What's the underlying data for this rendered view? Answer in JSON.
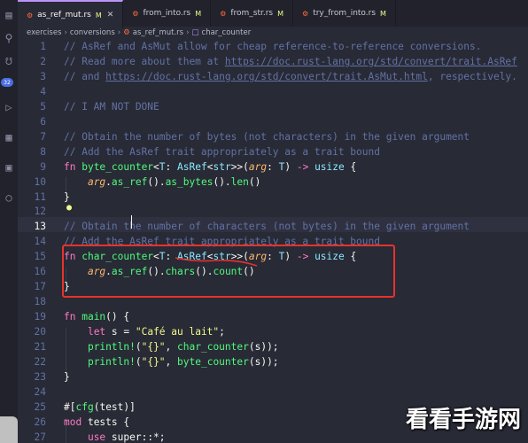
{
  "tabs": [
    {
      "name": "as_ref_mut.rs",
      "modified": "M",
      "active": true
    },
    {
      "name": "from_into.rs",
      "modified": "M",
      "active": false
    },
    {
      "name": "from_str.rs",
      "modified": "M",
      "active": false
    },
    {
      "name": "try_from_into.rs",
      "modified": "M",
      "active": false
    }
  ],
  "breadcrumb": {
    "parts": [
      "exercises",
      "conversions",
      "as_ref_mut.rs",
      "char_counter"
    ]
  },
  "activity_bar": {
    "icons": [
      "files-icon",
      "search-icon",
      "source-control-icon",
      "run-debug-icon",
      "extensions-icon",
      "remote-icon",
      "accounts-icon"
    ],
    "badge": "32"
  },
  "lines": [
    {
      "n": "1",
      "segs": [
        [
          "c",
          "// AsRef and AsMut allow for cheap reference-to-reference conversions."
        ]
      ]
    },
    {
      "n": "2",
      "segs": [
        [
          "c",
          "// Read more about them at "
        ],
        [
          "c u",
          "https://doc.rust-lang.org/std/convert/trait.AsRef"
        ]
      ]
    },
    {
      "n": "3",
      "segs": [
        [
          "c",
          "// and "
        ],
        [
          "c u",
          "https://doc.rust-lang.org/std/convert/trait.AsMut.html"
        ],
        [
          "c",
          ", respectively."
        ]
      ]
    },
    {
      "n": "4",
      "segs": []
    },
    {
      "n": "5",
      "segs": [
        [
          "c",
          "// I AM NOT DONE"
        ]
      ]
    },
    {
      "n": "6",
      "segs": []
    },
    {
      "n": "7",
      "segs": [
        [
          "c",
          "// Obtain the number of bytes (not characters) in the given argument"
        ]
      ]
    },
    {
      "n": "8",
      "segs": [
        [
          "c",
          "// Add the AsRef trait appropriately as a trait bound"
        ]
      ]
    },
    {
      "n": "9",
      "segs": [
        [
          "k",
          "fn "
        ],
        [
          "f",
          "byte_counter"
        ],
        [
          "",
          "<"
        ],
        [
          "t",
          "T"
        ],
        [
          "",
          ": "
        ],
        [
          "t",
          "AsRef"
        ],
        [
          "",
          "<"
        ],
        [
          "t",
          "str"
        ],
        [
          "",
          ">>("
        ],
        [
          "p",
          "arg"
        ],
        [
          "",
          ": "
        ],
        [
          "t",
          "T"
        ],
        [
          "",
          ") "
        ],
        [
          "k",
          "-> "
        ],
        [
          "t",
          "usize"
        ],
        [
          "",
          " {"
        ]
      ]
    },
    {
      "n": "10",
      "segs": [
        [
          "",
          "    "
        ],
        [
          "p",
          "arg"
        ],
        [
          "",
          "."
        ],
        [
          "m",
          "as_ref"
        ],
        [
          "",
          "()."
        ],
        [
          "m",
          "as_bytes"
        ],
        [
          "",
          "()."
        ],
        [
          "m",
          "len"
        ],
        [
          "",
          "()"
        ]
      ]
    },
    {
      "n": "11",
      "segs": [
        [
          "",
          "}"
        ]
      ]
    },
    {
      "n": "12",
      "segs": []
    },
    {
      "n": "13",
      "segs": [
        [
          "c",
          "// Obtain the number of characters (not bytes) in the given argument"
        ]
      ]
    },
    {
      "n": "14",
      "segs": [
        [
          "c",
          "// Add the AsRef trait appropriately as a trait bound"
        ]
      ]
    },
    {
      "n": "15",
      "segs": [
        [
          "k",
          "fn "
        ],
        [
          "f",
          "char_counter"
        ],
        [
          "",
          "<"
        ],
        [
          "t",
          "T"
        ],
        [
          "",
          ": "
        ],
        [
          "t",
          "AsRef"
        ],
        [
          "",
          "<"
        ],
        [
          "t",
          "str"
        ],
        [
          "",
          ">>("
        ],
        [
          "p",
          "arg"
        ],
        [
          "",
          ": "
        ],
        [
          "t",
          "T"
        ],
        [
          "",
          ") "
        ],
        [
          "k",
          "-> "
        ],
        [
          "t",
          "usize"
        ],
        [
          "",
          " {"
        ]
      ]
    },
    {
      "n": "16",
      "segs": [
        [
          "",
          "    "
        ],
        [
          "p",
          "arg"
        ],
        [
          "",
          "."
        ],
        [
          "m",
          "as_ref"
        ],
        [
          "",
          "()."
        ],
        [
          "m",
          "chars"
        ],
        [
          "",
          "()."
        ],
        [
          "m",
          "count"
        ],
        [
          "",
          "()"
        ]
      ]
    },
    {
      "n": "17",
      "segs": [
        [
          "",
          "}"
        ]
      ]
    },
    {
      "n": "18",
      "segs": []
    },
    {
      "n": "19",
      "segs": [
        [
          "k",
          "fn "
        ],
        [
          "f",
          "main"
        ],
        [
          "",
          "() {"
        ]
      ]
    },
    {
      "n": "20",
      "segs": [
        [
          "",
          "    "
        ],
        [
          "k",
          "let "
        ],
        [
          "",
          "s = "
        ],
        [
          "s",
          "\"Café au lait\""
        ],
        [
          "",
          ";"
        ]
      ]
    },
    {
      "n": "21",
      "segs": [
        [
          "",
          "    "
        ],
        [
          "f",
          "println!"
        ],
        [
          "",
          "("
        ],
        [
          "s",
          "\"{}\""
        ],
        [
          "",
          ", "
        ],
        [
          "f",
          "char_counter"
        ],
        [
          "",
          "(s));"
        ]
      ]
    },
    {
      "n": "22",
      "segs": [
        [
          "",
          "    "
        ],
        [
          "f",
          "println!"
        ],
        [
          "",
          "("
        ],
        [
          "s",
          "\"{}\""
        ],
        [
          "",
          ", "
        ],
        [
          "f",
          "byte_counter"
        ],
        [
          "",
          "(s));"
        ]
      ]
    },
    {
      "n": "23",
      "segs": [
        [
          "",
          "}"
        ]
      ]
    },
    {
      "n": "24",
      "segs": []
    },
    {
      "n": "25",
      "segs": [
        [
          "",
          "#["
        ],
        [
          "f",
          "cfg"
        ],
        [
          "",
          "("
        ],
        [
          "",
          "test"
        ],
        [
          "",
          ")]"
        ]
      ]
    },
    {
      "n": "26",
      "segs": [
        [
          "k",
          "mod "
        ],
        [
          "",
          "tests {"
        ]
      ]
    },
    {
      "n": "27",
      "segs": [
        [
          "",
          "    "
        ],
        [
          "k",
          "use "
        ],
        [
          "",
          "super::*;"
        ]
      ]
    }
  ],
  "current_line": "13",
  "watermark": "看看手游网",
  "colors": {
    "accent": "#bd93f9",
    "annotation": "#e8322a"
  }
}
